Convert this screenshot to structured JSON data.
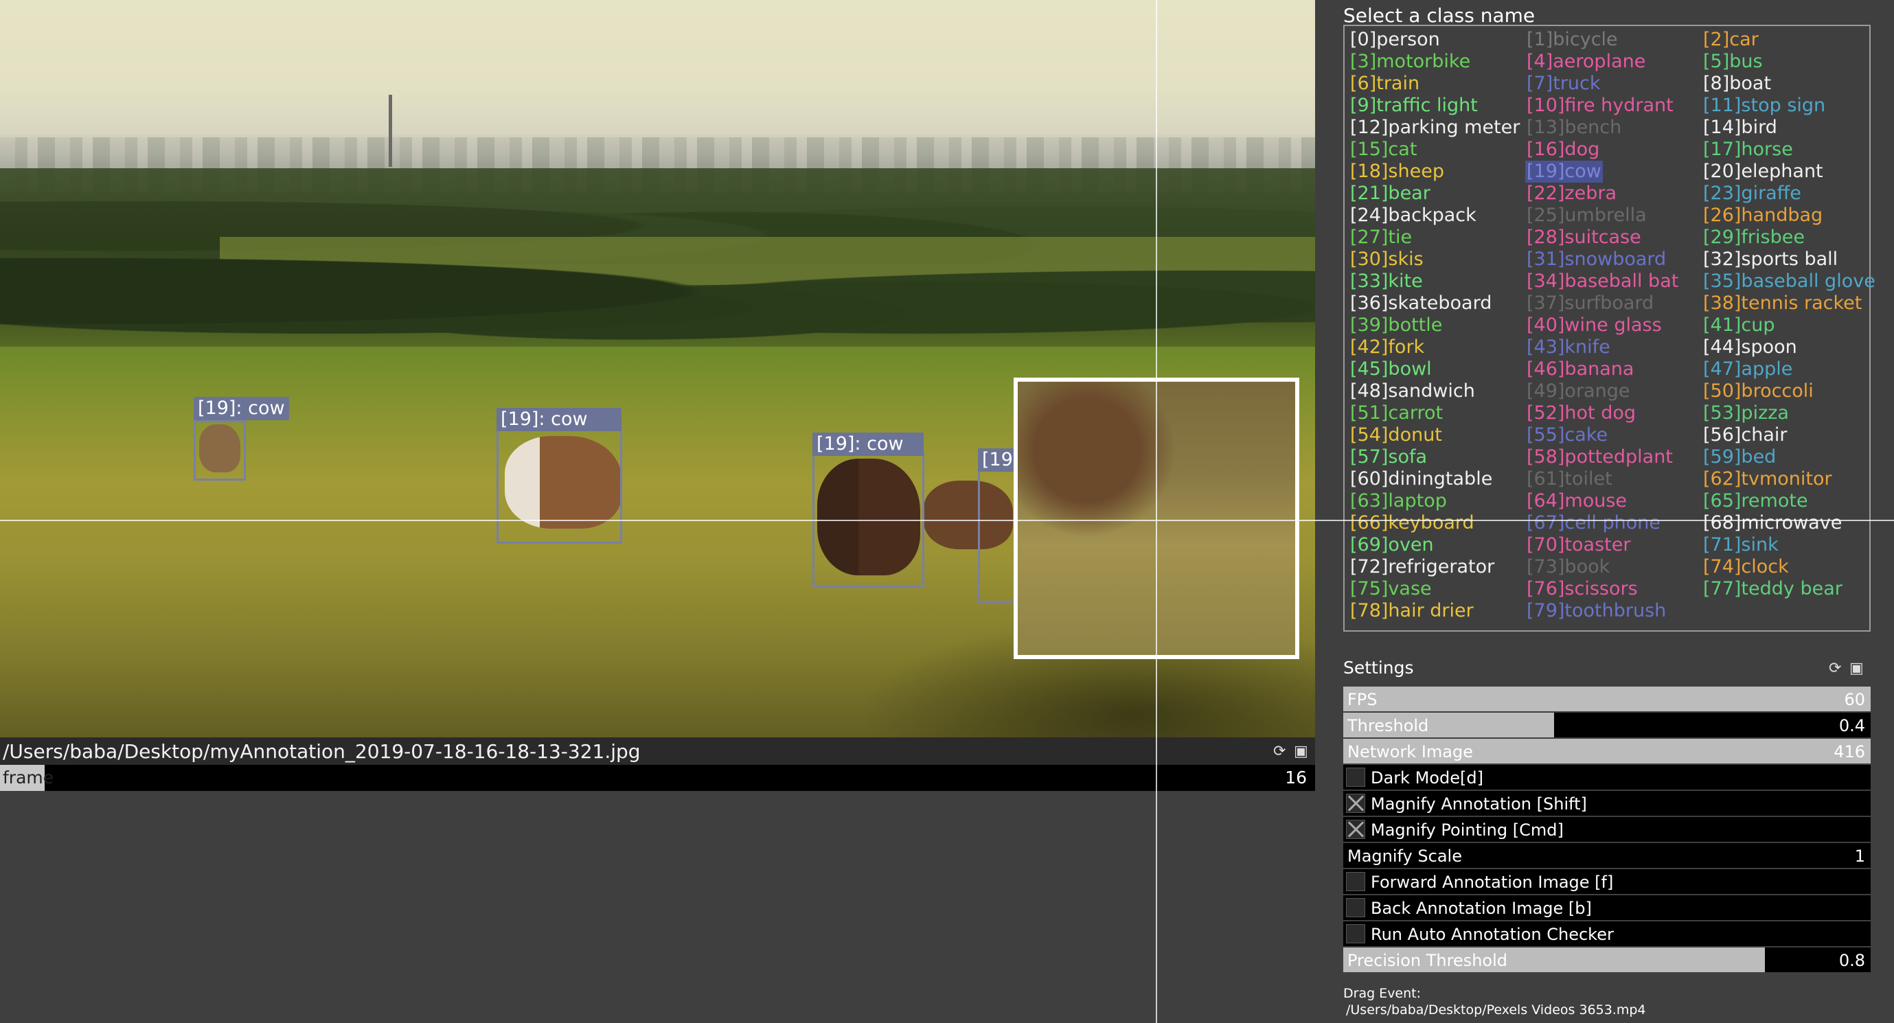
{
  "image_panel": {
    "annotations": [
      {
        "label": "[19]: cow"
      },
      {
        "label": "[19]: cow"
      },
      {
        "label": "[19]: cow"
      },
      {
        "label": "[19"
      }
    ],
    "file_path": "/Users/baba/Desktop/myAnnotation_2019-07-18-16-18-13-321.jpg",
    "frame": {
      "label": "frame",
      "value": "16",
      "progress": 0.02
    }
  },
  "class_panel": {
    "title": "Select a class name",
    "selected_index": 19,
    "classes": [
      {
        "text": "[0]person",
        "color": "#f0f0f0"
      },
      {
        "text": "[1]bicycle",
        "color": "#7a7a7a"
      },
      {
        "text": "[2]car",
        "color": "#e8a23c"
      },
      {
        "text": "[3]motorbike",
        "color": "#69d15a"
      },
      {
        "text": "[4]aeroplane",
        "color": "#e35aa0"
      },
      {
        "text": "[5]bus",
        "color": "#5fcf7a"
      },
      {
        "text": "[6]train",
        "color": "#e8c33c"
      },
      {
        "text": "[7]truck",
        "color": "#6a73c9"
      },
      {
        "text": "[8]boat",
        "color": "#f0f0f0"
      },
      {
        "text": "[9]traffic light",
        "color": "#6de07a"
      },
      {
        "text": "[10]fire hydrant",
        "color": "#e35aa0"
      },
      {
        "text": "[11]stop sign",
        "color": "#4fa7c9"
      },
      {
        "text": "[12]parking meter",
        "color": "#f0f0f0"
      },
      {
        "text": "[13]bench",
        "color": "#6a6a6a"
      },
      {
        "text": "[14]bird",
        "color": "#f0f0f0"
      },
      {
        "text": "[15]cat",
        "color": "#69d15a"
      },
      {
        "text": "[16]dog",
        "color": "#e35aa0"
      },
      {
        "text": "[17]horse",
        "color": "#5fcf7a"
      },
      {
        "text": "[18]sheep",
        "color": "#e8c33c"
      },
      {
        "text": "[19]cow",
        "color": "#5a63b8"
      },
      {
        "text": "[20]elephant",
        "color": "#f0f0f0"
      },
      {
        "text": "[21]bear",
        "color": "#6de07a"
      },
      {
        "text": "[22]zebra",
        "color": "#e35aa0"
      },
      {
        "text": "[23]giraffe",
        "color": "#4fa7c9"
      },
      {
        "text": "[24]backpack",
        "color": "#f0f0f0"
      },
      {
        "text": "[25]umbrella",
        "color": "#6a6a6a"
      },
      {
        "text": "[26]handbag",
        "color": "#e8a23c"
      },
      {
        "text": "[27]tie",
        "color": "#69d15a"
      },
      {
        "text": "[28]suitcase",
        "color": "#e35aa0"
      },
      {
        "text": "[29]frisbee",
        "color": "#5fcf7a"
      },
      {
        "text": "[30]skis",
        "color": "#e8c33c"
      },
      {
        "text": "[31]snowboard",
        "color": "#6a73c9"
      },
      {
        "text": "[32]sports ball",
        "color": "#f0f0f0"
      },
      {
        "text": "[33]kite",
        "color": "#6de07a"
      },
      {
        "text": "[34]baseball bat",
        "color": "#e35aa0"
      },
      {
        "text": "[35]baseball glove",
        "color": "#4fa7c9"
      },
      {
        "text": "[36]skateboard",
        "color": "#f0f0f0"
      },
      {
        "text": "[37]surfboard",
        "color": "#6a6a6a"
      },
      {
        "text": "[38]tennis racket",
        "color": "#e8a23c"
      },
      {
        "text": "[39]bottle",
        "color": "#69d15a"
      },
      {
        "text": "[40]wine glass",
        "color": "#e35aa0"
      },
      {
        "text": "[41]cup",
        "color": "#5fcf7a"
      },
      {
        "text": "[42]fork",
        "color": "#e8c33c"
      },
      {
        "text": "[43]knife",
        "color": "#6a73c9"
      },
      {
        "text": "[44]spoon",
        "color": "#f0f0f0"
      },
      {
        "text": "[45]bowl",
        "color": "#6de07a"
      },
      {
        "text": "[46]banana",
        "color": "#e35aa0"
      },
      {
        "text": "[47]apple",
        "color": "#4fa7c9"
      },
      {
        "text": "[48]sandwich",
        "color": "#f0f0f0"
      },
      {
        "text": "[49]orange",
        "color": "#6a6a6a"
      },
      {
        "text": "[50]broccoli",
        "color": "#e8a23c"
      },
      {
        "text": "[51]carrot",
        "color": "#69d15a"
      },
      {
        "text": "[52]hot dog",
        "color": "#e35aa0"
      },
      {
        "text": "[53]pizza",
        "color": "#5fcf7a"
      },
      {
        "text": "[54]donut",
        "color": "#e8c33c"
      },
      {
        "text": "[55]cake",
        "color": "#6a73c9"
      },
      {
        "text": "[56]chair",
        "color": "#f0f0f0"
      },
      {
        "text": "[57]sofa",
        "color": "#6de07a"
      },
      {
        "text": "[58]pottedplant",
        "color": "#e35aa0"
      },
      {
        "text": "[59]bed",
        "color": "#4fa7c9"
      },
      {
        "text": "[60]diningtable",
        "color": "#f0f0f0"
      },
      {
        "text": "[61]toilet",
        "color": "#6a6a6a"
      },
      {
        "text": "[62]tvmonitor",
        "color": "#e8a23c"
      },
      {
        "text": "[63]laptop",
        "color": "#69d15a"
      },
      {
        "text": "[64]mouse",
        "color": "#e35aa0"
      },
      {
        "text": "[65]remote",
        "color": "#5fcf7a"
      },
      {
        "text": "[66]keyboard",
        "color": "#e8c33c"
      },
      {
        "text": "[67]cell phone",
        "color": "#6a73c9"
      },
      {
        "text": "[68]microwave",
        "color": "#f0f0f0"
      },
      {
        "text": "[69]oven",
        "color": "#6de07a"
      },
      {
        "text": "[70]toaster",
        "color": "#e35aa0"
      },
      {
        "text": "[71]sink",
        "color": "#4fa7c9"
      },
      {
        "text": "[72]refrigerator",
        "color": "#f0f0f0"
      },
      {
        "text": "[73]book",
        "color": "#6a6a6a"
      },
      {
        "text": "[74]clock",
        "color": "#e8a23c"
      },
      {
        "text": "[75]vase",
        "color": "#69d15a"
      },
      {
        "text": "[76]scissors",
        "color": "#e35aa0"
      },
      {
        "text": "[77]teddy bear",
        "color": "#5fcf7a"
      },
      {
        "text": "[78]hair drier",
        "color": "#e8c33c"
      },
      {
        "text": "[79]toothbrush",
        "color": "#6a73c9"
      }
    ]
  },
  "settings": {
    "title": "Settings",
    "fps": {
      "label": "FPS",
      "value": "60",
      "level": 1.0
    },
    "threshold": {
      "label": "Threshold",
      "value": "0.4",
      "level": 0.4
    },
    "network_image": {
      "label": "Network Image",
      "value": "416",
      "level": 1.0
    },
    "dark_mode": {
      "label": "Dark Mode[d]",
      "checked": false
    },
    "magnify_annotation": {
      "label": "Magnify Annotation [Shift]",
      "checked": true
    },
    "magnify_pointing": {
      "label": "Magnify Pointing [Cmd]",
      "checked": true
    },
    "magnify_scale": {
      "label": "Magnify Scale",
      "value": "1",
      "level": 0.0
    },
    "forward_annotation": {
      "label": "Forward Annotation Image [f]",
      "checked": false
    },
    "back_annotation": {
      "label": "Back Annotation Image [b]",
      "checked": false
    },
    "auto_checker": {
      "label": "Run Auto Annotation Checker",
      "checked": false
    },
    "precision_threshold": {
      "label": "Precision Threshold",
      "value": "0.8",
      "level": 0.8
    }
  },
  "drag_event": {
    "title": "Drag Event:",
    "path": "/Users/baba/Desktop/Pexels Videos 3653.mp4"
  },
  "icons": {
    "refresh": "refresh-icon",
    "save": "save-icon"
  }
}
